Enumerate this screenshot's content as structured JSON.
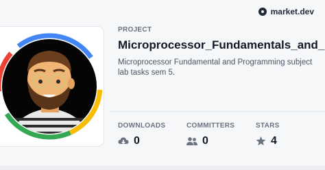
{
  "brand": {
    "name": "market.dev"
  },
  "project": {
    "kicker": "PROJECT",
    "title": "Microprocessor_Fundamentals_and_Pr",
    "description": "Microprocessor Fundamental and Programming subject lab tasks sem 5."
  },
  "stats": {
    "downloads": {
      "label": "DOWNLOADS",
      "value": "0",
      "icon": "cloud-download-icon"
    },
    "committers": {
      "label": "COMMITTERS",
      "value": "0",
      "icon": "users-icon"
    },
    "stars": {
      "label": "STARS",
      "value": "4",
      "icon": "star-icon"
    }
  },
  "colors": {
    "ring_red": "#ea4335",
    "ring_blue": "#4285f4",
    "ring_green": "#34a853",
    "ring_yellow": "#fbbc05",
    "text_muted": "#6b7280",
    "text_strong": "#111827"
  }
}
